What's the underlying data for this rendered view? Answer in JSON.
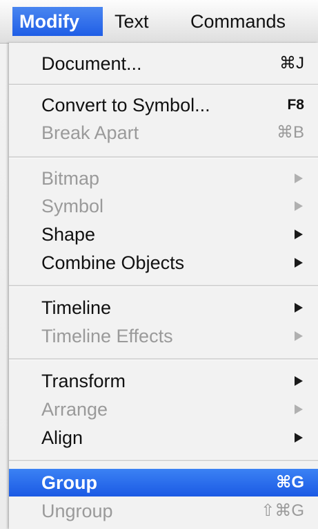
{
  "menubar": {
    "items": [
      {
        "label": "Modify"
      },
      {
        "label": "Text"
      },
      {
        "label": "Commands"
      }
    ]
  },
  "menu": {
    "items": [
      {
        "label": "Document...",
        "shortcut": "⌘J"
      },
      {
        "label": "Convert to Symbol...",
        "shortcut": "F8"
      },
      {
        "label": "Break Apart",
        "shortcut": "⌘B"
      },
      {
        "label": "Bitmap"
      },
      {
        "label": "Symbol"
      },
      {
        "label": "Shape"
      },
      {
        "label": "Combine Objects"
      },
      {
        "label": "Timeline"
      },
      {
        "label": "Timeline Effects"
      },
      {
        "label": "Transform"
      },
      {
        "label": "Arrange"
      },
      {
        "label": "Align"
      },
      {
        "label": "Group",
        "shortcut": "⌘G"
      },
      {
        "label": "Ungroup",
        "shortcut": "⇧⌘G"
      }
    ]
  },
  "colors": {
    "highlight": "#2a6ef0",
    "disabled_text": "#9a9a9a"
  }
}
